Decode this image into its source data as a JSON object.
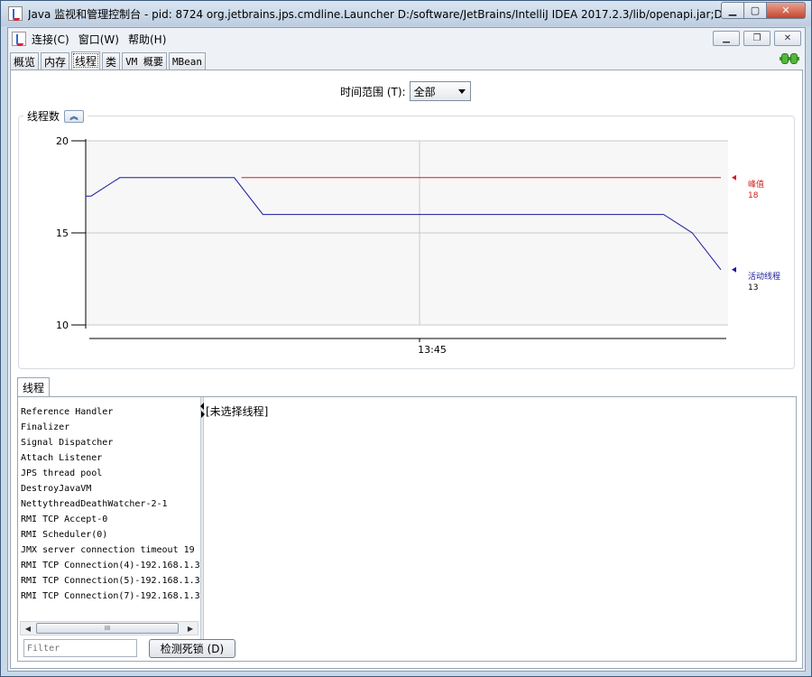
{
  "window": {
    "title": "Java 监视和管理控制台 - pid: 8724 org.jetbrains.jps.cmdline.Launcher D:/software/JetBrains/IntelliJ IDEA 2017.2.3/lib/openapi.jar;D:..."
  },
  "menu": {
    "items": [
      "连接(C)",
      "窗口(W)",
      "帮助(H)"
    ]
  },
  "tabs": [
    "概览",
    "内存",
    "线程",
    "类",
    "VM 概要",
    "MBean"
  ],
  "active_tab": "线程",
  "time_range": {
    "label": "时间范围 (T):",
    "selected": "全部"
  },
  "chart_title": "线程数",
  "chart_data": {
    "type": "line",
    "title": "线程数",
    "ylim": [
      10,
      20
    ],
    "yticks": [
      10,
      15,
      20
    ],
    "xtick_label": "13:45",
    "x": [
      0,
      1,
      5,
      6,
      20,
      21,
      22
    ],
    "series": [
      {
        "name": "峰值",
        "color": "#d42020",
        "values": [
          17,
          18,
          18,
          18,
          18,
          18,
          18
        ],
        "current": 18
      },
      {
        "name": "活动线程",
        "color": "#1a1a9e",
        "values": [
          17,
          18,
          18,
          16,
          16,
          15,
          13
        ],
        "current": 13
      }
    ]
  },
  "threads_tab": "线程",
  "threads": [
    "Reference Handler",
    "Finalizer",
    "Signal Dispatcher",
    "Attach Listener",
    "JPS thread pool",
    "DestroyJavaVM",
    "NettythreadDeathWatcher-2-1",
    "RMI TCP Accept-0",
    "RMI Scheduler(0)",
    "JMX server connection timeout 19",
    "RMI TCP Connection(4)-192.168.1.3",
    "RMI TCP Connection(5)-192.168.1.3",
    "RMI TCP Connection(7)-192.168.1.3"
  ],
  "detail_text": "[未选择线程]",
  "filter": {
    "placeholder": "Filter",
    "value": ""
  },
  "detect_button": "检测死锁 (D)",
  "scroll_grip": "III"
}
